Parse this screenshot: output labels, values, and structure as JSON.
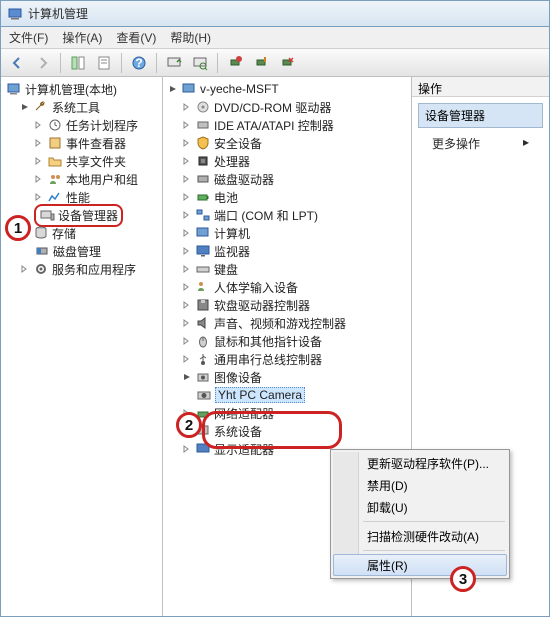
{
  "window": {
    "title": "计算机管理"
  },
  "menu": {
    "file": "文件(F)",
    "action": "操作(A)",
    "view": "查看(V)",
    "help": "帮助(H)"
  },
  "left_tree": {
    "root": "计算机管理(本地)",
    "systools": "系统工具",
    "systools_children": {
      "scheduler": "任务计划程序",
      "eventviewer": "事件查看器",
      "shared": "共享文件夹",
      "localusers": "本地用户和组",
      "perf": "性能",
      "devmgr": "设备管理器"
    },
    "storage": "存储",
    "storage_children": {
      "diskmgmt": "磁盘管理"
    },
    "services": "服务和应用程序"
  },
  "mid_tree": {
    "root": "v-yeche-MSFT",
    "items": {
      "dvd": "DVD/CD-ROM 驱动器",
      "ide": "IDE ATA/ATAPI 控制器",
      "security": "安全设备",
      "cpu": "处理器",
      "disk": "磁盘驱动器",
      "battery": "电池",
      "ports": "端口 (COM 和 LPT)",
      "computer": "计算机",
      "monitor": "监视器",
      "keyboard": "键盘",
      "hid": "人体学输入设备",
      "floppyctl": "软盘驱动器控制器",
      "sound": "声音、视频和游戏控制器",
      "mouse": "鼠标和其他指针设备",
      "usb": "通用串行总线控制器",
      "imaging": "图像设备",
      "camera": "Yht PC Camera",
      "network": "网络适配器",
      "sysdev": "系统设备",
      "display": "显示适配器"
    }
  },
  "right": {
    "header": "操作",
    "section_title": "设备管理器",
    "more": "更多操作"
  },
  "context_menu": {
    "update": "更新驱动程序软件(P)...",
    "disable": "禁用(D)",
    "uninstall": "卸载(U)",
    "scan": "扫描检测硬件改动(A)",
    "properties": "属性(R)"
  },
  "callouts": {
    "c1": "1",
    "c2": "2",
    "c3": "3"
  }
}
